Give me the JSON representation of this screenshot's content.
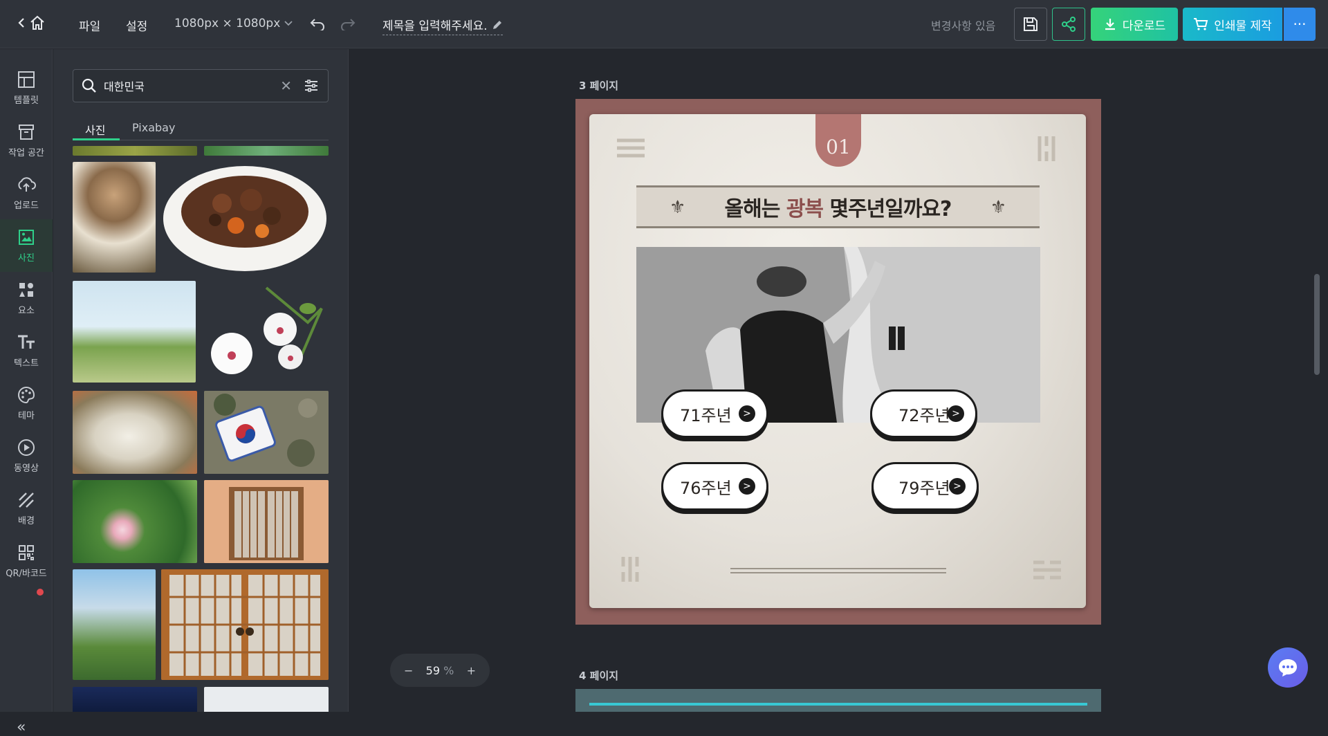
{
  "topbar": {
    "menu_file": "파일",
    "menu_settings": "설정",
    "size_label": "1080px × 1080px",
    "title": "제목을 입력해주세요.",
    "status": "변경사항 있음",
    "download_label": "다운로드",
    "print_label": "인쇄물 제작",
    "more_label": "···"
  },
  "leftnav": {
    "items": [
      {
        "label": "템플릿",
        "icon": "template-icon"
      },
      {
        "label": "작업 공간",
        "icon": "workspace-icon"
      },
      {
        "label": "업로드",
        "icon": "upload-icon"
      },
      {
        "label": "사진",
        "icon": "photo-icon"
      },
      {
        "label": "요소",
        "icon": "elements-icon"
      },
      {
        "label": "텍스트",
        "icon": "text-icon"
      },
      {
        "label": "테마",
        "icon": "palette-icon"
      },
      {
        "label": "동영상",
        "icon": "video-icon"
      },
      {
        "label": "배경",
        "icon": "background-icon"
      },
      {
        "label": "QR/바코드",
        "icon": "qr-icon"
      }
    ],
    "active": "사진",
    "collapse_label": "«"
  },
  "panel": {
    "search_value": "대한민국",
    "tabs": [
      "사진",
      "Pixabay"
    ],
    "active_tab": "사진"
  },
  "canvas": {
    "page3_label": "3 페이지",
    "page4_label": "4 페이지",
    "number_badge": "01",
    "question_prefix": "올해는 ",
    "question_highlight": "광복",
    "question_suffix": " 몇주년일까요?",
    "answers": [
      "71주년",
      "72주년",
      "76주년",
      "79주년"
    ],
    "accent_color": "#8c4f4d"
  },
  "zoom": {
    "minus": "−",
    "value": "59",
    "unit": "%",
    "plus": "+"
  },
  "colors": {
    "brand_green": "#2fd08a",
    "download_gradient": "#35d37a",
    "print_gradient": "#1ab9c9",
    "page_border": "#8e5f5c"
  }
}
